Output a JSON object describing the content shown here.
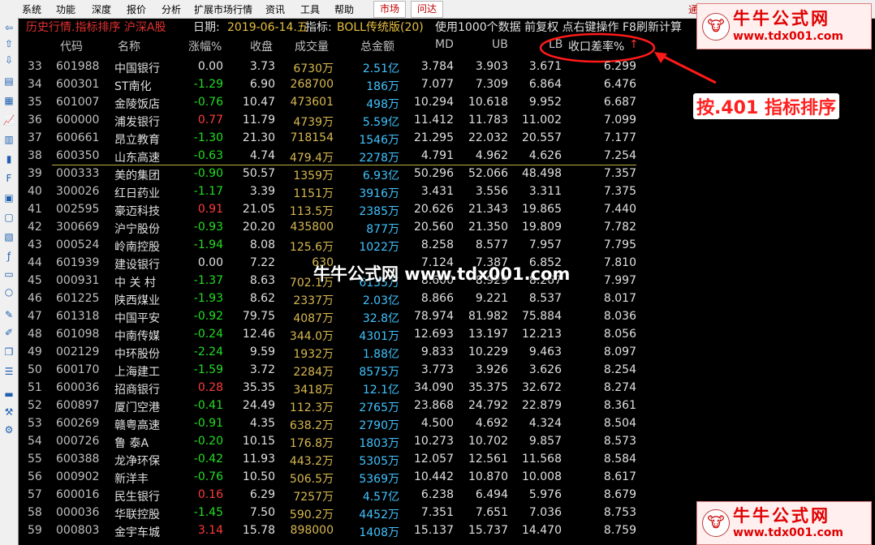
{
  "menu": {
    "items": [
      "系统",
      "功能",
      "深度",
      "报价",
      "分析",
      "扩展市场行情",
      "资讯",
      "工具",
      "帮助"
    ],
    "market_btn": "市场",
    "wenda_btn": "问达",
    "right_text": "通"
  },
  "titlebar": {
    "prefix": "历史行情.指标排序 沪深A股",
    "date_label": "日期:",
    "date_value": "2019-06-14.五",
    "indicator_label": "指标:",
    "indicator_value": "BOLL传统版(20)",
    "suffix": "使用1000个数据 前复权 点右键操作 F8刷新计算"
  },
  "headers": {
    "code": "代码",
    "name": "名称",
    "change_pct": "涨幅%",
    "close": "收盘",
    "volume": "成交量",
    "amount": "总金额",
    "md": "MD",
    "ub": "UB",
    "lb": "LB",
    "rate": "收口差率%",
    "rate_arrow": "↑"
  },
  "rows": [
    {
      "idx": "33",
      "code": "601988",
      "name": "中国银行",
      "chg": "0.00",
      "dir": "flat",
      "close": "3.73",
      "vol": "6730万",
      "amt": "2.51亿",
      "md": "3.784",
      "ub": "3.903",
      "lb": "3.671",
      "rate": "6.299"
    },
    {
      "idx": "34",
      "code": "600301",
      "name": "ST南化",
      "chg": "-1.29",
      "dir": "down",
      "close": "6.90",
      "vol": "268700",
      "amt": "186万",
      "md": "7.077",
      "ub": "7.309",
      "lb": "6.864",
      "rate": "6.476"
    },
    {
      "idx": "35",
      "code": "601007",
      "name": "金陵饭店",
      "chg": "-0.76",
      "dir": "down",
      "close": "10.47",
      "vol": "473601",
      "amt": "498万",
      "md": "10.294",
      "ub": "10.618",
      "lb": "9.952",
      "rate": "6.687"
    },
    {
      "idx": "36",
      "code": "600000",
      "name": "浦发银行",
      "chg": "0.77",
      "dir": "up",
      "close": "11.79",
      "vol": "4739万",
      "amt": "5.59亿",
      "md": "11.412",
      "ub": "11.783",
      "lb": "11.002",
      "rate": "7.099"
    },
    {
      "idx": "37",
      "code": "600661",
      "name": "昂立教育",
      "chg": "-1.30",
      "dir": "down",
      "close": "21.30",
      "vol": "718154",
      "amt": "1546万",
      "md": "21.295",
      "ub": "22.032",
      "lb": "20.557",
      "rate": "7.177"
    },
    {
      "idx": "38",
      "code": "600350",
      "name": "山东高速",
      "chg": "-0.63",
      "dir": "down",
      "close": "4.74",
      "vol": "479.4万",
      "amt": "2278万",
      "md": "4.791",
      "ub": "4.962",
      "lb": "4.626",
      "rate": "7.254"
    },
    {
      "idx": "39",
      "code": "000333",
      "name": "美的集团",
      "chg": "-0.90",
      "dir": "down",
      "close": "50.57",
      "vol": "1359万",
      "amt": "6.93亿",
      "md": "50.296",
      "ub": "52.066",
      "lb": "48.498",
      "rate": "7.357"
    },
    {
      "idx": "40",
      "code": "300026",
      "name": "红日药业",
      "chg": "-1.17",
      "dir": "down",
      "close": "3.39",
      "vol": "1151万",
      "amt": "3916万",
      "md": "3.431",
      "ub": "3.556",
      "lb": "3.311",
      "rate": "7.375"
    },
    {
      "idx": "41",
      "code": "002595",
      "name": "豪迈科技",
      "chg": "0.91",
      "dir": "up",
      "close": "21.05",
      "vol": "113.5万",
      "amt": "2385万",
      "md": "20.626",
      "ub": "21.343",
      "lb": "19.865",
      "rate": "7.440"
    },
    {
      "idx": "42",
      "code": "300669",
      "name": "沪宁股份",
      "chg": "-0.93",
      "dir": "down",
      "close": "20.20",
      "vol": "435800",
      "amt": "877万",
      "md": "20.560",
      "ub": "21.350",
      "lb": "19.809",
      "rate": "7.782"
    },
    {
      "idx": "43",
      "code": "000524",
      "name": "岭南控股",
      "chg": "-1.94",
      "dir": "down",
      "close": "8.08",
      "vol": "125.6万",
      "amt": "1022万",
      "md": "8.258",
      "ub": "8.577",
      "lb": "7.957",
      "rate": "7.795"
    },
    {
      "idx": "44",
      "code": "601939",
      "name": "建设银行",
      "chg": "0.00",
      "dir": "flat",
      "close": "7.22",
      "vol": "630",
      "amt": "",
      "md": "7.124",
      "ub": "7.387",
      "lb": "6.852",
      "rate": "7.810"
    },
    {
      "idx": "45",
      "code": "000931",
      "name": "中 关 村",
      "chg": "-1.37",
      "dir": "down",
      "close": "8.63",
      "vol": "702.1万",
      "amt": "6135万",
      "md": "8.600",
      "ub": "8.929",
      "lb": "8.267",
      "rate": "7.997"
    },
    {
      "idx": "46",
      "code": "601225",
      "name": "陕西煤业",
      "chg": "-1.93",
      "dir": "down",
      "close": "8.62",
      "vol": "2337万",
      "amt": "2.03亿",
      "md": "8.866",
      "ub": "9.221",
      "lb": "8.537",
      "rate": "8.017"
    },
    {
      "idx": "47",
      "code": "601318",
      "name": "中国平安",
      "chg": "-0.92",
      "dir": "down",
      "close": "79.75",
      "vol": "4087万",
      "amt": "32.8亿",
      "md": "78.974",
      "ub": "81.982",
      "lb": "75.884",
      "rate": "8.036"
    },
    {
      "idx": "48",
      "code": "601098",
      "name": "中南传媒",
      "chg": "-0.24",
      "dir": "down",
      "close": "12.46",
      "vol": "344.0万",
      "amt": "4301万",
      "md": "12.693",
      "ub": "13.197",
      "lb": "12.213",
      "rate": "8.056"
    },
    {
      "idx": "49",
      "code": "002129",
      "name": "中环股份",
      "chg": "-2.24",
      "dir": "down",
      "close": "9.59",
      "vol": "1932万",
      "amt": "1.88亿",
      "md": "9.833",
      "ub": "10.229",
      "lb": "9.463",
      "rate": "8.097"
    },
    {
      "idx": "50",
      "code": "600170",
      "name": "上海建工",
      "chg": "-1.59",
      "dir": "down",
      "close": "3.72",
      "vol": "2284万",
      "amt": "8575万",
      "md": "3.773",
      "ub": "3.926",
      "lb": "3.626",
      "rate": "8.254"
    },
    {
      "idx": "51",
      "code": "600036",
      "name": "招商银行",
      "chg": "0.28",
      "dir": "up",
      "close": "35.35",
      "vol": "3418万",
      "amt": "12.1亿",
      "md": "34.090",
      "ub": "35.375",
      "lb": "32.672",
      "rate": "8.274"
    },
    {
      "idx": "52",
      "code": "600897",
      "name": "厦门空港",
      "chg": "-0.41",
      "dir": "down",
      "close": "24.49",
      "vol": "112.3万",
      "amt": "2765万",
      "md": "23.868",
      "ub": "24.792",
      "lb": "22.879",
      "rate": "8.361"
    },
    {
      "idx": "53",
      "code": "600269",
      "name": "赣粤高速",
      "chg": "-0.91",
      "dir": "down",
      "close": "4.35",
      "vol": "638.2万",
      "amt": "2790万",
      "md": "4.500",
      "ub": "4.692",
      "lb": "4.324",
      "rate": "8.504"
    },
    {
      "idx": "54",
      "code": "000726",
      "name": "鲁 泰A",
      "chg": "-0.20",
      "dir": "down",
      "close": "10.15",
      "vol": "176.8万",
      "amt": "1803万",
      "md": "10.273",
      "ub": "10.702",
      "lb": "9.857",
      "rate": "8.573"
    },
    {
      "idx": "55",
      "code": "600388",
      "name": "龙净环保",
      "chg": "-0.42",
      "dir": "down",
      "close": "11.93",
      "vol": "443.2万",
      "amt": "5305万",
      "md": "12.057",
      "ub": "12.561",
      "lb": "11.568",
      "rate": "8.584"
    },
    {
      "idx": "56",
      "code": "000902",
      "name": "新洋丰",
      "chg": "-0.76",
      "dir": "down",
      "close": "10.50",
      "vol": "506.5万",
      "amt": "5369万",
      "md": "10.442",
      "ub": "10.870",
      "lb": "10.008",
      "rate": "8.617"
    },
    {
      "idx": "57",
      "code": "600016",
      "name": "民生银行",
      "chg": "0.16",
      "dir": "up",
      "close": "6.29",
      "vol": "7257万",
      "amt": "4.57亿",
      "md": "6.238",
      "ub": "6.494",
      "lb": "5.976",
      "rate": "8.679"
    },
    {
      "idx": "58",
      "code": "000036",
      "name": "华联控股",
      "chg": "-1.45",
      "dir": "down",
      "close": "7.50",
      "vol": "590.2万",
      "amt": "4452万",
      "md": "7.351",
      "ub": "7.651",
      "lb": "7.036",
      "rate": "8.753"
    },
    {
      "idx": "59",
      "code": "000803",
      "name": "金宇车城",
      "chg": "3.14",
      "dir": "up",
      "close": "15.78",
      "vol": "898000",
      "amt": "1408万",
      "md": "15.137",
      "ub": "15.737",
      "lb": "14.470",
      "rate": "8.759"
    }
  ],
  "overlay": {
    "logo_title": "牛牛公式网",
    "logo_url": "www.tdx001.com",
    "watermark": "牛牛公式网 www.tdx001.com",
    "annotation": "按.401 指标排序"
  },
  "colors": {
    "up": "#ff3b3b",
    "down": "#22dd22",
    "amount": "#3fc4ff",
    "volume": "#d8b850",
    "title_red": "#e03030",
    "title_date": "#e8c040",
    "annotation_red": "#ff2020"
  }
}
